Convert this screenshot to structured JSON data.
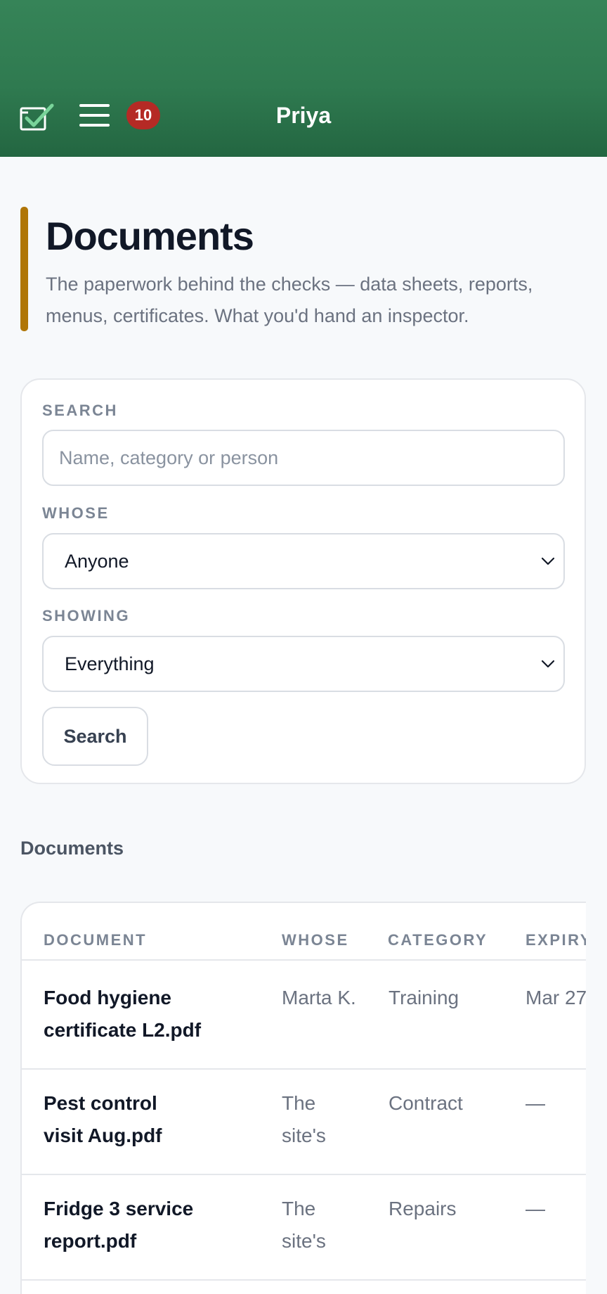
{
  "header": {
    "logo_icon": "checklist-icon",
    "menu_icon": "hamburger-icon",
    "notification_count": "10",
    "user_name": "Priya",
    "colors": {
      "bar": "#2f7a50",
      "badge": "#b52a25"
    }
  },
  "intro": {
    "title": "Documents",
    "description": "The paperwork behind the checks — data sheets, reports, menus, certificates. What you'd hand an inspector.",
    "accent_color": "#b07607"
  },
  "filters": {
    "search_label": "SEARCH",
    "search_placeholder": "Name, category or person",
    "whose_label": "WHOSE",
    "whose_value": "Anyone",
    "showing_label": "SHOWING",
    "showing_value": "Everything",
    "search_button": "Search"
  },
  "documents": {
    "section_title": "Documents",
    "columns": [
      "DOCUMENT",
      "WHOSE",
      "CATEGORY",
      "EXPIRY"
    ],
    "rows": [
      {
        "name": "Food hygiene certificate L2.pdf",
        "whose": "Marta K.",
        "category": "Training",
        "expiry": "Mar 27"
      },
      {
        "name": "Pest control visit Aug.pdf",
        "whose": "The site's",
        "category": "Contract",
        "expiry": "—"
      },
      {
        "name": "Fridge 3 service report.pdf",
        "whose": "The site's",
        "category": "Repairs",
        "expiry": "—"
      }
    ]
  }
}
